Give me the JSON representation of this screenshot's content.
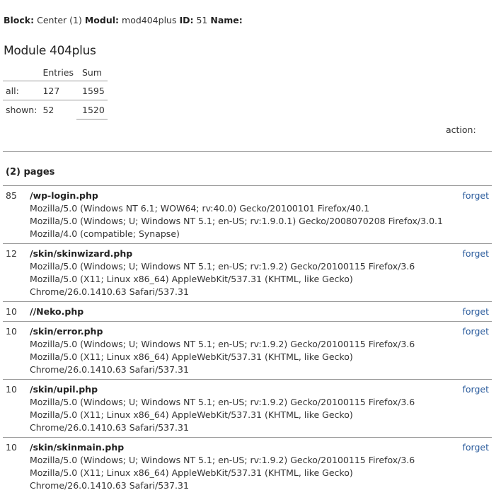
{
  "info": {
    "block_label": "Block:",
    "block_value": "Center (1)",
    "modul_label": "Modul:",
    "modul_value": "mod404plus",
    "id_label": "ID:",
    "id_value": "51",
    "name_label": "Name:"
  },
  "title": "Module 404plus",
  "stats": {
    "headers": [
      "",
      "Entries",
      "Sum"
    ],
    "rows": [
      {
        "label": "all:",
        "entries": "127",
        "sum": "1595"
      },
      {
        "label": "shown:",
        "entries": "52",
        "sum": "1520"
      }
    ]
  },
  "action_label": "action:",
  "pages_title": "(2) pages",
  "forget_label": "forget",
  "items": [
    {
      "count": "85",
      "path": "/wp-login.php",
      "agents": [
        "Mozilla/5.0 (Windows NT 6.1; WOW64; rv:40.0) Gecko/20100101 Firefox/40.1",
        "Mozilla/5.0 (Windows; U; Windows NT 5.1; en-US; rv:1.9.0.1) Gecko/2008070208 Firefox/3.0.1",
        "Mozilla/4.0 (compatible; Synapse)"
      ]
    },
    {
      "count": "12",
      "path": "/skin/skinwizard.php",
      "agents": [
        "Mozilla/5.0 (Windows; U; Windows NT 5.1; en-US; rv:1.9.2) Gecko/20100115 Firefox/3.6",
        "Mozilla/5.0 (X11; Linux x86_64) AppleWebKit/537.31 (KHTML, like Gecko) Chrome/26.0.1410.63 Safari/537.31"
      ]
    },
    {
      "count": "10",
      "path": "//Neko.php",
      "agents": []
    },
    {
      "count": "10",
      "path": "/skin/error.php",
      "agents": [
        "Mozilla/5.0 (Windows; U; Windows NT 5.1; en-US; rv:1.9.2) Gecko/20100115 Firefox/3.6",
        "Mozilla/5.0 (X11; Linux x86_64) AppleWebKit/537.31 (KHTML, like Gecko) Chrome/26.0.1410.63 Safari/537.31"
      ]
    },
    {
      "count": "10",
      "path": "/skin/upil.php",
      "agents": [
        "Mozilla/5.0 (Windows; U; Windows NT 5.1; en-US; rv:1.9.2) Gecko/20100115 Firefox/3.6",
        "Mozilla/5.0 (X11; Linux x86_64) AppleWebKit/537.31 (KHTML, like Gecko) Chrome/26.0.1410.63 Safari/537.31"
      ]
    },
    {
      "count": "10",
      "path": "/skin/skinmain.php",
      "agents": [
        "Mozilla/5.0 (Windows; U; Windows NT 5.1; en-US; rv:1.9.2) Gecko/20100115 Firefox/3.6",
        "Mozilla/5.0 (X11; Linux x86_64) AppleWebKit/537.31 (KHTML, like Gecko) Chrome/26.0.1410.63 Safari/537.31"
      ]
    }
  ]
}
